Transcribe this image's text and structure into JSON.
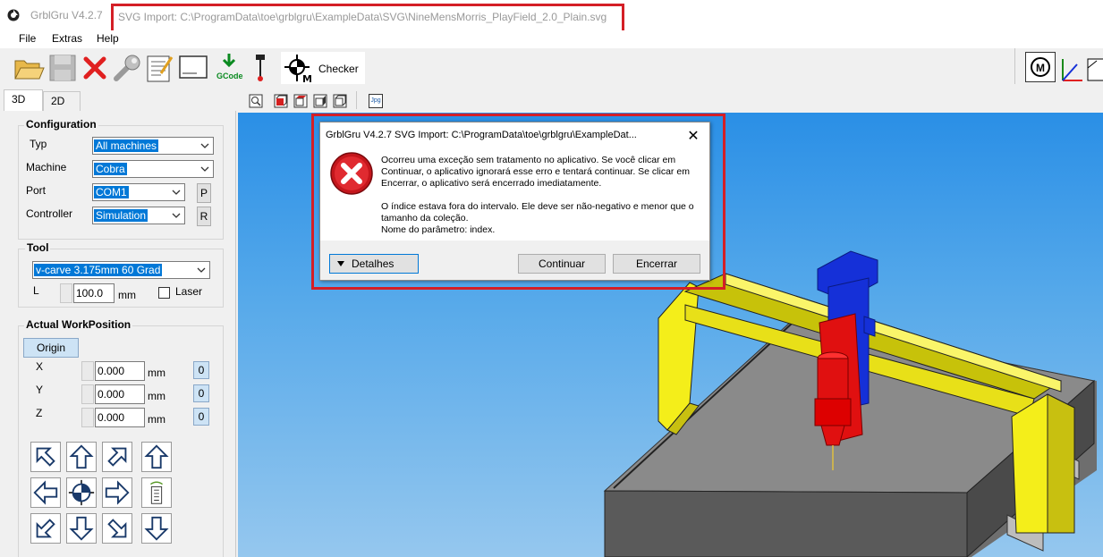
{
  "window": {
    "app_title": "GrblGru V4.2.7",
    "document_title": "SVG Import: C:\\ProgramData\\toe\\grblgru\\ExampleData\\SVG\\NineMensMorris_PlayField_2.0_Plain.svg"
  },
  "menu": {
    "items": [
      "File",
      "Extras",
      "Help"
    ]
  },
  "toolbar": {
    "gcode_label": "GCode",
    "checker_label": "Checker",
    "right_button_label": "M"
  },
  "tabs": [
    "3D",
    "2D"
  ],
  "configuration": {
    "title": "Configuration",
    "type_label": "Typ",
    "type_value": "All machines",
    "machine_label": "Machine",
    "machine_value": "Cobra",
    "port_label": "Port",
    "port_value": "COM1",
    "port_button": "P",
    "controller_label": "Controller",
    "controller_value": "Simulation",
    "controller_button": "R"
  },
  "tool": {
    "title": "Tool",
    "tool_value": "v-carve 3.175mm 60 Grad",
    "length_label": "L",
    "length_value": "100.0",
    "length_unit": "mm",
    "laser_label": "Laser"
  },
  "work_position": {
    "title": "Actual WorkPosition",
    "origin_button": "Origin",
    "axes": [
      {
        "name": "X",
        "value": "0.000",
        "unit": "mm",
        "zero": "0"
      },
      {
        "name": "Y",
        "value": "0.000",
        "unit": "mm",
        "zero": "0"
      },
      {
        "name": "Z",
        "value": "0.000",
        "unit": "mm",
        "zero": "0"
      }
    ]
  },
  "view_toolbar": {
    "jpg_label": "Jpg"
  },
  "dialog": {
    "title": "GrblGru V4.2.7      SVG Import: C:\\ProgramData\\toe\\grblgru\\ExampleDat...",
    "close": "✕",
    "message_1": "Ocorreu uma exceção sem tratamento no aplicativo. Se você clicar em Continuar, o aplicativo ignorará esse erro e tentará continuar. Se clicar em Encerrar, o aplicativo será encerrado imediatamente.",
    "message_2": "O índice estava fora do intervalo. Ele deve ser não-negativo e menor que o tamanho da coleção.",
    "message_3": "Nome do parâmetro: index.",
    "details_button": "Detalhes",
    "continue_button": "Continuar",
    "quit_button": "Encerrar"
  },
  "colors": {
    "highlight_red": "#d41f26",
    "selection_blue": "#0078d7",
    "viewport_sky": "#4aa3ea",
    "machine_yellow": "#f4ee1a",
    "machine_blue": "#1530d8",
    "machine_red": "#e01010",
    "table_gray": "#7a7a7a"
  }
}
